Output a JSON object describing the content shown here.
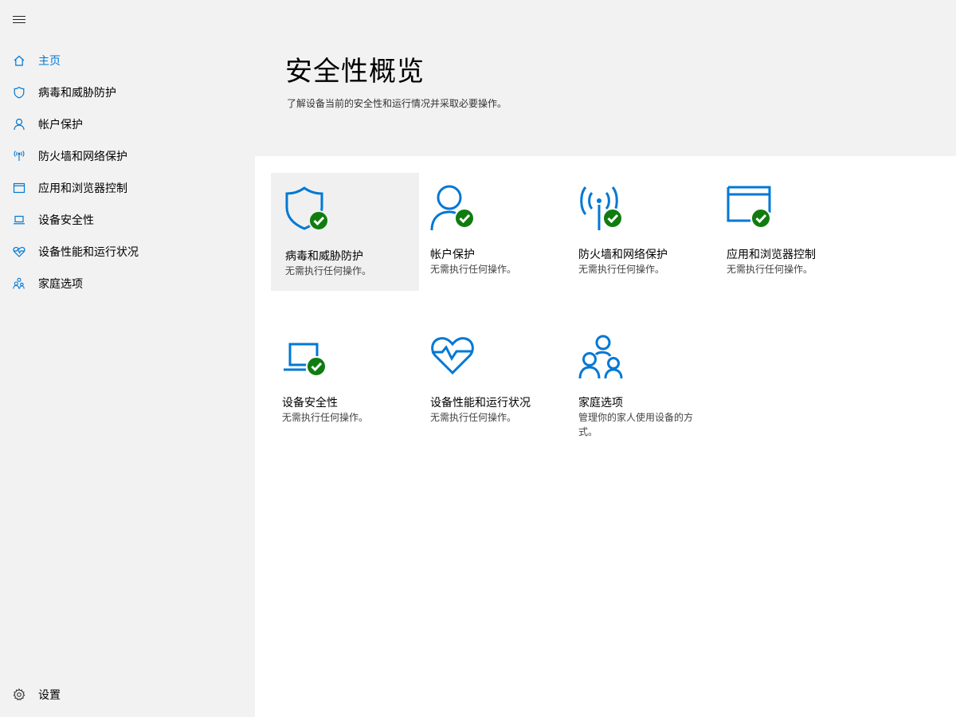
{
  "nav": {
    "menu_icon": "hamburger-icon",
    "items": [
      {
        "label": "主页",
        "icon": "home-icon",
        "active": true
      },
      {
        "label": "病毒和威胁防护",
        "icon": "shield-icon"
      },
      {
        "label": "帐户保护",
        "icon": "person-icon"
      },
      {
        "label": "防火墙和网络保护",
        "icon": "antenna-icon"
      },
      {
        "label": "应用和浏览器控制",
        "icon": "browser-window-icon"
      },
      {
        "label": "设备安全性",
        "icon": "laptop-icon"
      },
      {
        "label": "设备性能和运行状况",
        "icon": "heart-pulse-icon"
      },
      {
        "label": "家庭选项",
        "icon": "family-icon"
      }
    ],
    "settings": {
      "label": "设置",
      "icon": "gear-icon"
    }
  },
  "header": {
    "title": "安全性概览",
    "subtitle": "了解设备当前的安全性和运行情况并采取必要操作。"
  },
  "tiles": [
    {
      "title": "病毒和威胁防护",
      "status": "无需执行任何操作。",
      "icon": "shield-check-icon"
    },
    {
      "title": "帐户保护",
      "status": "无需执行任何操作。",
      "icon": "person-check-icon"
    },
    {
      "title": "防火墙和网络保护",
      "status": "无需执行任何操作。",
      "icon": "antenna-check-icon"
    },
    {
      "title": "应用和浏览器控制",
      "status": "无需执行任何操作。",
      "icon": "browser-check-icon"
    },
    {
      "title": "设备安全性",
      "status": "无需执行任何操作。",
      "icon": "laptop-check-icon"
    },
    {
      "title": "设备性能和运行状况",
      "status": "无需执行任何操作。",
      "icon": "heart-pulse-icon"
    },
    {
      "title": "家庭选项",
      "status": "管理你的家人使用设备的方式。",
      "icon": "family-icon"
    }
  ],
  "colors": {
    "accent": "#0078d4",
    "ok": "#107c10",
    "sidebar_bg": "#f2f2f2"
  }
}
